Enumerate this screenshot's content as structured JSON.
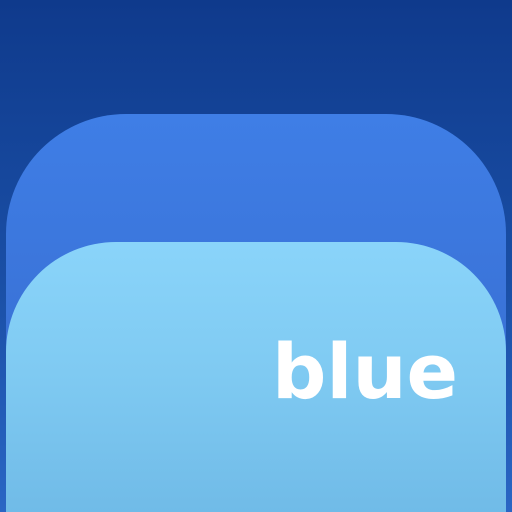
{
  "icon": {
    "wordmark": "blue"
  }
}
